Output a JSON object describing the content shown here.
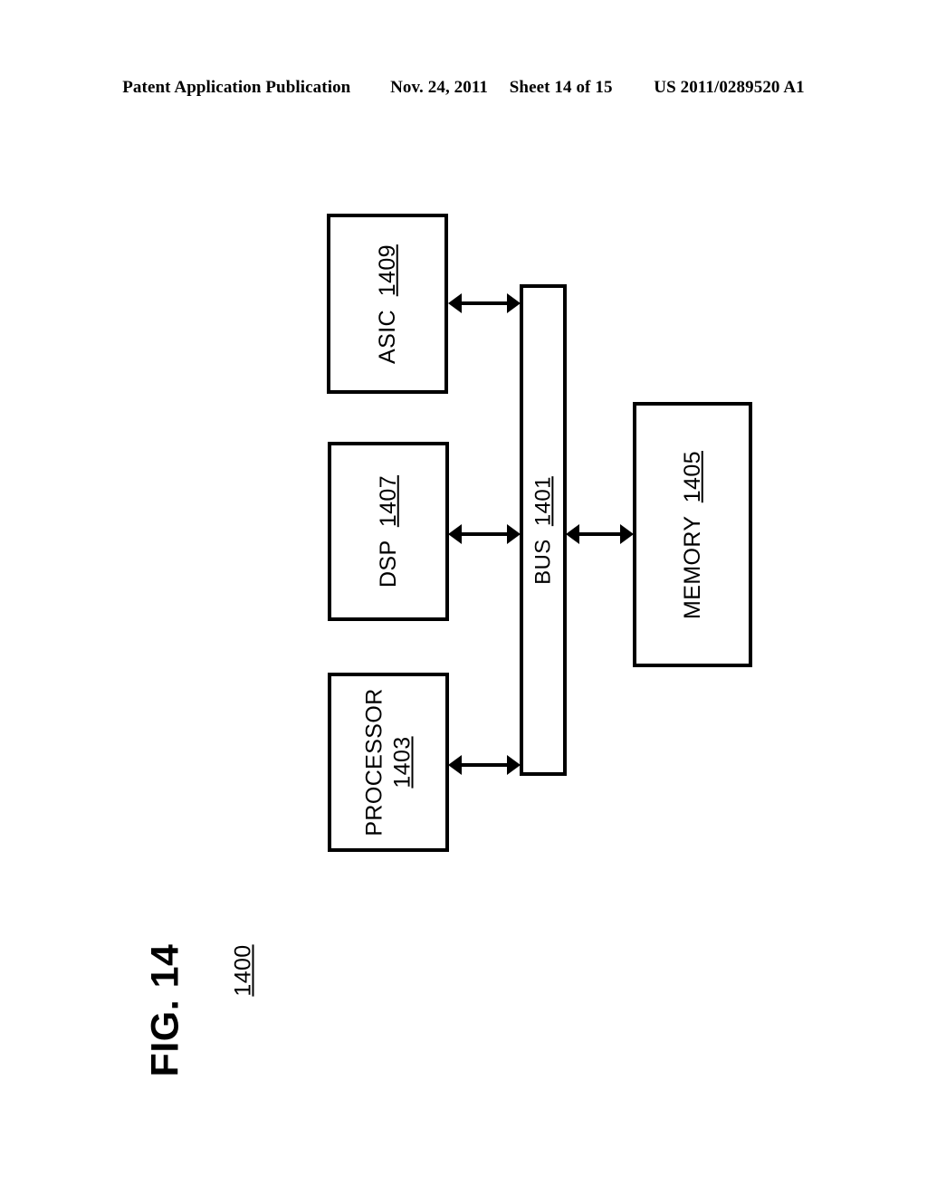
{
  "header": {
    "publication": "Patent Application Publication",
    "date": "Nov. 24, 2011",
    "sheet": "Sheet 14 of 15",
    "patent_number": "US 2011/0289520 A1"
  },
  "figure": {
    "label": "FIG. 14",
    "reference_number": "1400"
  },
  "diagram": {
    "type": "block-diagram",
    "orientation": "rotated-90-ccw",
    "nodes": [
      {
        "id": "asic",
        "name": "ASIC",
        "ref": "1409",
        "label": "ASIC 1409"
      },
      {
        "id": "dsp",
        "name": "DSP",
        "ref": "1407",
        "label": "DSP 1407"
      },
      {
        "id": "processor",
        "name": "PROCESSOR",
        "ref": "1403",
        "label": "PROCESSOR 1403"
      },
      {
        "id": "bus",
        "name": "BUS",
        "ref": "1401",
        "label": "BUS 1401"
      },
      {
        "id": "memory",
        "name": "MEMORY",
        "ref": "1405",
        "label": "MEMORY 1405"
      }
    ],
    "connections": [
      {
        "from": "asic",
        "to": "bus",
        "arrow": "bidirectional"
      },
      {
        "from": "dsp",
        "to": "bus",
        "arrow": "bidirectional"
      },
      {
        "from": "processor",
        "to": "bus",
        "arrow": "bidirectional"
      },
      {
        "from": "bus",
        "to": "memory",
        "arrow": "bidirectional"
      }
    ]
  },
  "colors": {
    "ink": "#000000",
    "paper": "#ffffff"
  }
}
